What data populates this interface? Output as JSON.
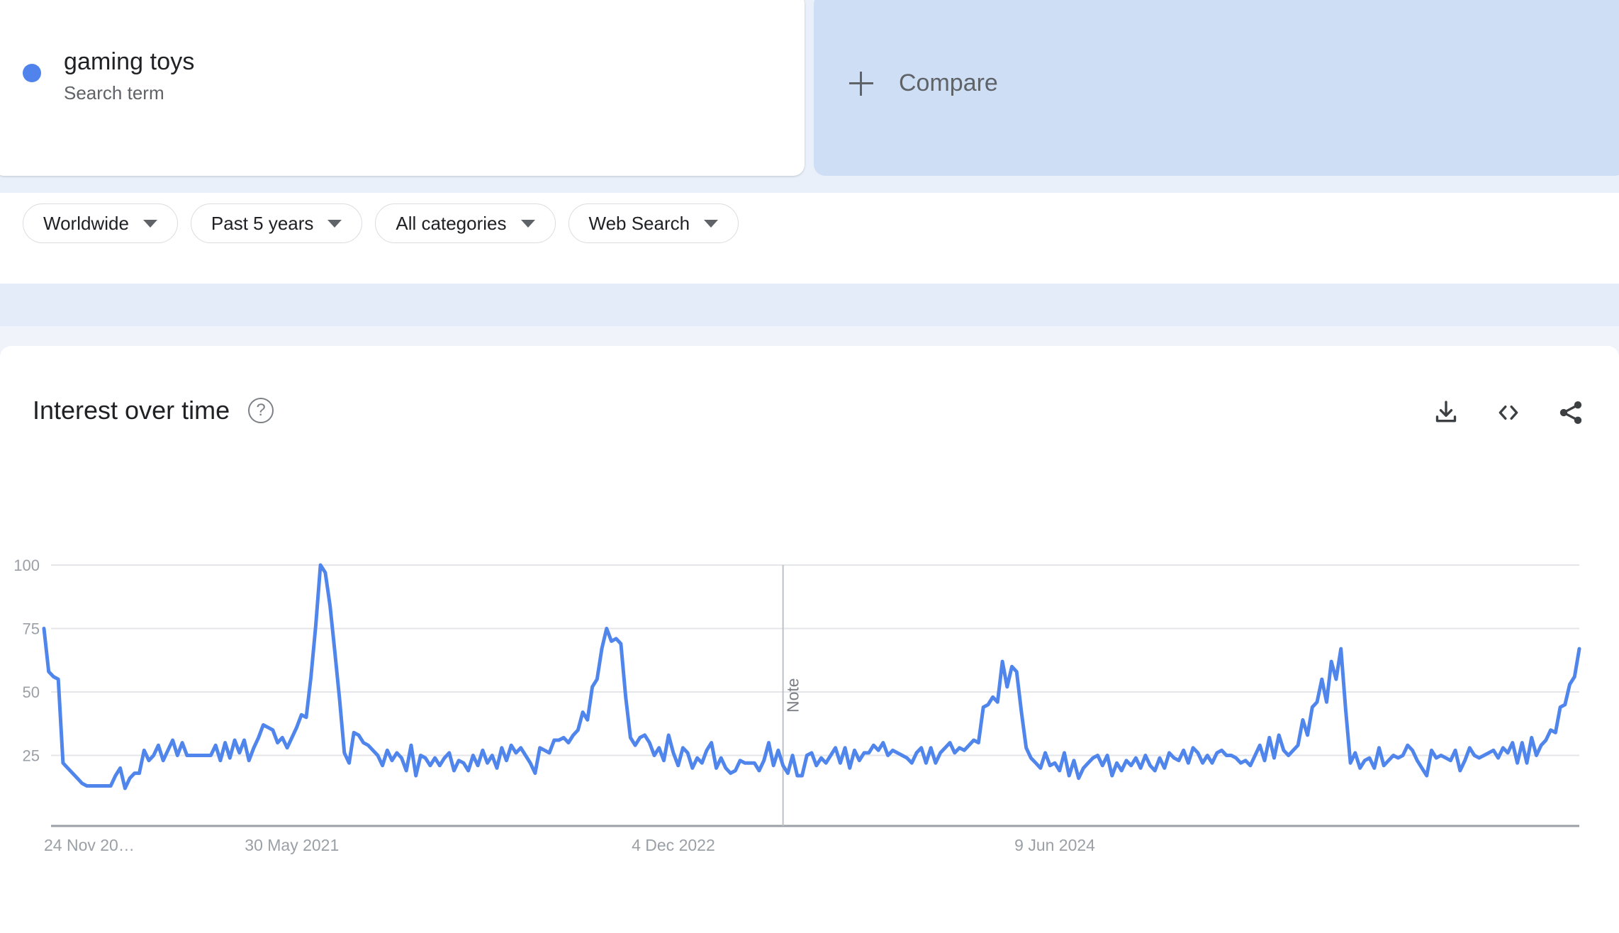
{
  "term_card": {
    "name": "gaming toys",
    "subtitle": "Search term",
    "dot_color": "#5084ec"
  },
  "compare_card": {
    "label": "Compare",
    "icon": "plus-icon",
    "background": "#cedff5"
  },
  "filters": [
    {
      "label": "Worldwide",
      "icon": "chevron-down-icon"
    },
    {
      "label": "Past 5 years",
      "icon": "chevron-down-icon"
    },
    {
      "label": "All categories",
      "icon": "chevron-down-icon"
    },
    {
      "label": "Web Search",
      "icon": "chevron-down-icon"
    }
  ],
  "chart_section": {
    "title": "Interest over time",
    "help_icon": "help-circle-icon",
    "help_glyph": "?",
    "actions": [
      {
        "name": "download-icon",
        "tooltip": "Download"
      },
      {
        "name": "embed-code-icon",
        "tooltip": "Embed"
      },
      {
        "name": "share-icon",
        "tooltip": "Share"
      }
    ]
  },
  "chart_data": {
    "type": "line",
    "title": "Interest over time",
    "xlabel": "",
    "ylabel": "",
    "ylim": [
      0,
      105
    ],
    "yticks": [
      25,
      50,
      75,
      100
    ],
    "grid": true,
    "legend": false,
    "line_color": "#5086ec",
    "line_width": 5,
    "x_tick_labels": [
      "24 Nov 20…",
      "30 May 2021",
      "4 Dec 2022",
      "9 Jun 2024"
    ],
    "x_tick_positions": [
      0,
      52,
      132,
      212
    ],
    "annotations": [
      {
        "label": "Note",
        "x_index": 155,
        "orientation": "vertical"
      }
    ],
    "series": [
      {
        "name": "gaming toys",
        "color": "#5086ec",
        "values": [
          75,
          58,
          56,
          55,
          22,
          20,
          18,
          16,
          14,
          13,
          13,
          13,
          13,
          13,
          13,
          17,
          20,
          12,
          16,
          18,
          18,
          27,
          23,
          25,
          29,
          23,
          27,
          31,
          25,
          30,
          25,
          25,
          25,
          25,
          25,
          25,
          29,
          23,
          30,
          24,
          31,
          26,
          31,
          23,
          28,
          32,
          37,
          36,
          35,
          30,
          32,
          28,
          32,
          36,
          41,
          40,
          56,
          76,
          100,
          97,
          84,
          66,
          47,
          26,
          22,
          34,
          33,
          30,
          29,
          27,
          25,
          21,
          27,
          23,
          26,
          24,
          19,
          29,
          17,
          25,
          24,
          21,
          24,
          21,
          24,
          26,
          19,
          23,
          22,
          19,
          25,
          21,
          27,
          22,
          25,
          20,
          28,
          23,
          29,
          26,
          28,
          25,
          22,
          18,
          28,
          27,
          26,
          31,
          31,
          32,
          30,
          33,
          35,
          42,
          39,
          52,
          55,
          67,
          75,
          70,
          71,
          69,
          48,
          32,
          29,
          32,
          33,
          30,
          25,
          28,
          23,
          33,
          26,
          21,
          28,
          26,
          20,
          24,
          22,
          27,
          30,
          20,
          24,
          20,
          18,
          19,
          23,
          22,
          22,
          22,
          19,
          23,
          30,
          21,
          27,
          21,
          18,
          25,
          17,
          17,
          25,
          26,
          21,
          24,
          22,
          25,
          28,
          22,
          28,
          20,
          27,
          23,
          26,
          26,
          29,
          27,
          30,
          25,
          27,
          26,
          25,
          24,
          22,
          26,
          28,
          22,
          28,
          22,
          26,
          28,
          30,
          26,
          28,
          27,
          29,
          31,
          30,
          44,
          45,
          48,
          46,
          62,
          52,
          60,
          58,
          42,
          28,
          24,
          22,
          20,
          26,
          21,
          22,
          19,
          26,
          17,
          23,
          16,
          20,
          22,
          24,
          25,
          21,
          25,
          17,
          22,
          19,
          23,
          21,
          24,
          20,
          25,
          21,
          19,
          24,
          20,
          26,
          24,
          23,
          27,
          22,
          28,
          26,
          22,
          25,
          22,
          26,
          27,
          25,
          25,
          24,
          22,
          23,
          21,
          25,
          29,
          23,
          32,
          24,
          33,
          27,
          25,
          27,
          29,
          39,
          33,
          44,
          46,
          55,
          46,
          62,
          55,
          67,
          43,
          22,
          26,
          20,
          23,
          24,
          20,
          28,
          21,
          23,
          25,
          24,
          25,
          29,
          27,
          23,
          20,
          17,
          27,
          24,
          25,
          24,
          23,
          27,
          19,
          23,
          28,
          25,
          24,
          25,
          26,
          27,
          24,
          28,
          26,
          30,
          22,
          30,
          22,
          32,
          25,
          29,
          31,
          35,
          34,
          44,
          45,
          53,
          56,
          67
        ]
      }
    ]
  }
}
